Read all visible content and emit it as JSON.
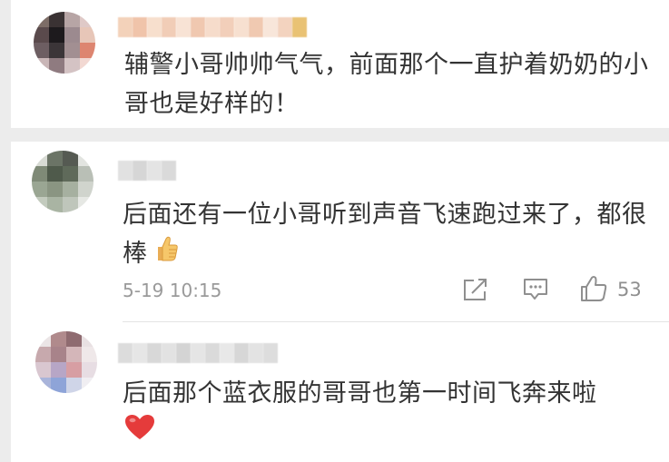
{
  "comments": [
    {
      "text": "辅警小哥帅帅气气，前面那个一直护着奶奶的小哥也是好样的！"
    },
    {
      "text": "后面还有一位小哥听到声音飞速跑过来了，都很棒",
      "emoji": "thumbs-up-emoji",
      "timestamp": "5-19 10:15",
      "like_count": "53"
    },
    {
      "text": "后面那个蓝衣服的哥哥也第一时间飞奔来啦",
      "emoji": "red-heart-emoji"
    }
  ],
  "colors": {
    "background": "#ececec",
    "card": "#ffffff",
    "text": "#333333",
    "meta": "#9a9a9a",
    "icon": "#8f8f8f",
    "heart": "#e53b3b"
  }
}
